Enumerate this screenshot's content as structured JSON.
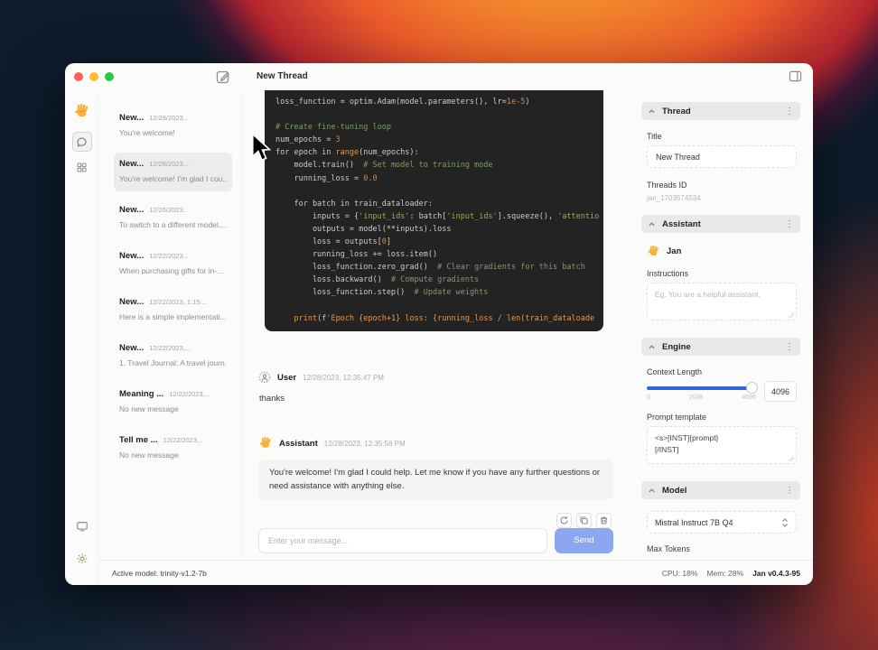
{
  "window": {
    "title": "New Thread",
    "status_left": "Active model: trinity-v1.2-7b",
    "status_cpu": "CPU: 18%",
    "status_mem": "Mem: 28%",
    "status_version": "Jan v0.4.3-95"
  },
  "threads": [
    {
      "title": "New...",
      "date": "12/28/2023...",
      "preview": "You're welcome!",
      "active": false
    },
    {
      "title": "New...",
      "date": "12/28/2023...",
      "preview": "You're welcome! I'm glad I cou...",
      "active": true
    },
    {
      "title": "New...",
      "date": "12/26/2023...",
      "preview": "To switch to a different model,...",
      "active": false
    },
    {
      "title": "New...",
      "date": "12/22/2023...",
      "preview": "When purchasing gifts for in-...",
      "active": false
    },
    {
      "title": "New...",
      "date": "12/22/2023, 1:15:...",
      "preview": "Here is a simple implementati...",
      "active": false
    },
    {
      "title": "New...",
      "date": "12/22/2023,...",
      "preview": "1. Travel Journal: A travel journ...",
      "active": false
    },
    {
      "title": "Meaning ...",
      "date": "12/22/2023,...",
      "preview": "No new message",
      "active": false
    },
    {
      "title": "Tell me ...",
      "date": "12/22/2023,...",
      "preview": "No new message",
      "active": false
    }
  ],
  "chat": {
    "code_lines": [
      [
        [
          "p",
          "loss_function = optim.Adam(model.parameters(), lr="
        ],
        [
          "n",
          "1e-5"
        ],
        [
          "p",
          ")"
        ]
      ],
      [],
      [
        [
          "c",
          "# Create fine-tuning loop"
        ]
      ],
      [
        [
          "p",
          "num_epochs = "
        ],
        [
          "n",
          "3"
        ]
      ],
      [
        [
          "p",
          "for epoch in "
        ],
        [
          "f",
          "range"
        ],
        [
          "p",
          "(num_epochs):"
        ]
      ],
      [
        [
          "p",
          "    model.train()  "
        ],
        [
          "c",
          "# Set model to training mode"
        ]
      ],
      [
        [
          "p",
          "    running_loss = "
        ],
        [
          "n",
          "0.0"
        ]
      ],
      [],
      [
        [
          "p",
          "    for batch in train_dataloader:"
        ]
      ],
      [
        [
          "p",
          "        inputs = {"
        ],
        [
          "s",
          "'input_ids'"
        ],
        [
          "p",
          ": batch["
        ],
        [
          "s",
          "'input_ids'"
        ],
        [
          "p",
          "].squeeze(), "
        ],
        [
          "s",
          "'attentio"
        ]
      ],
      [
        [
          "p",
          "        outputs = model(**inputs).loss"
        ]
      ],
      [
        [
          "p",
          "        loss = outputs["
        ],
        [
          "n",
          "0"
        ],
        [
          "p",
          "]"
        ]
      ],
      [
        [
          "p",
          "        running_loss += loss.item()"
        ]
      ],
      [
        [
          "p",
          "        loss_function.zero_grad()  "
        ],
        [
          "c",
          "# Clear gradients for this batch"
        ]
      ],
      [
        [
          "p",
          "        loss.backward()  "
        ],
        [
          "c",
          "# Compute gradients"
        ]
      ],
      [
        [
          "p",
          "        loss_function.step()  "
        ],
        [
          "c",
          "# Update weights"
        ]
      ],
      [],
      [
        [
          "p",
          "    "
        ],
        [
          "f",
          "print"
        ],
        [
          "p",
          "(f"
        ],
        [
          "f",
          "'Epoch {epoch+1} loss: {running_loss / len(train_dataloade"
        ]
      ]
    ],
    "messages": [
      {
        "role": "User",
        "time": "12/28/2023, 12:35:47 PM",
        "text": "thanks"
      },
      {
        "role": "Assistant",
        "time": "12/28/2023, 12:35:56 PM",
        "text": "You're welcome! I'm glad I could help. Let me know if you have any further questions or need assistance with anything else."
      }
    ],
    "input_placeholder": "Enter your message...",
    "send_label": "Send"
  },
  "panel": {
    "thread": {
      "header": "Thread",
      "title_label": "Title",
      "title_value": "New Thread",
      "id_label": "Threads ID",
      "id_value": "jan_1703574534"
    },
    "assistant": {
      "header": "Assistant",
      "name": "Jan",
      "instructions_label": "Instructions",
      "instructions_placeholder": "Eg. You are a helpful assistant."
    },
    "engine": {
      "header": "Engine",
      "context_label": "Context Length",
      "context_value": "4096",
      "ticks": [
        "0",
        "2048",
        "4096"
      ],
      "prompt_label": "Prompt template",
      "prompt_value": "<s>[INST]{prompt}\n[/INST]"
    },
    "model": {
      "header": "Model",
      "selected": "Mistral Instruct 7B Q4",
      "max_tokens_label": "Max Tokens"
    }
  },
  "colors": {
    "accent_blue": "#2f66df",
    "send_button": "#8ba7f0",
    "code_bg": "#232323"
  }
}
